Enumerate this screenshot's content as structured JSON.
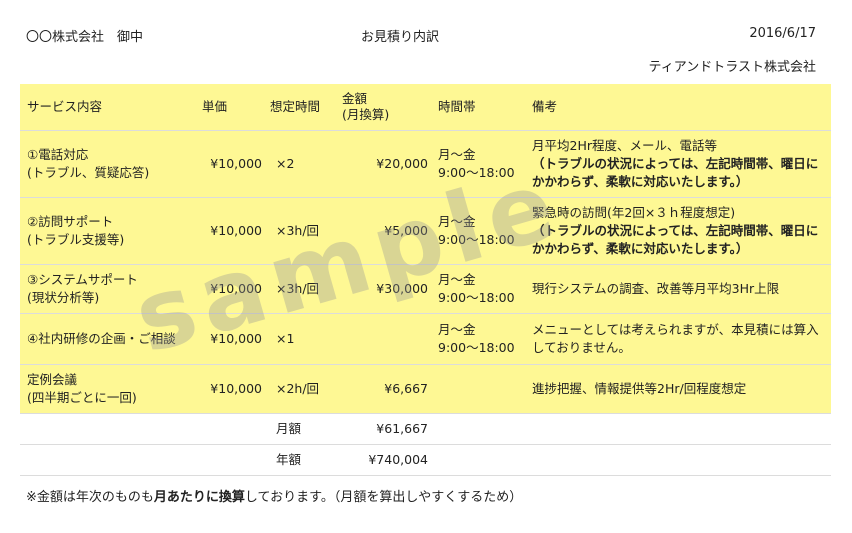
{
  "header": {
    "client": "〇〇株式会社　御中",
    "title": "お見積り内訳",
    "date": "2016/6/17",
    "company": "ティアンドトラスト株式会社"
  },
  "table": {
    "columns": {
      "service": "サービス内容",
      "unit_price": "単価",
      "expected_time": "想定時間",
      "amount_line1": "金額",
      "amount_line2": "(月換算)",
      "time_slot": "時間帯",
      "notes": "備考"
    },
    "rows": [
      {
        "service1": "①電話対応",
        "service2": "(トラブル、質疑応答)",
        "unit_price": "¥10,000",
        "expected_time": "×2",
        "amount": "¥20,000",
        "slot1": "月～金",
        "slot2": "9:00～18:00",
        "note1": "月平均2Hr程度、メール、電話等",
        "note_bold": "（トラブルの状況によっては、左記時間帯、曜日にかかわらず、柔軟に対応いたします。）"
      },
      {
        "service1": "②訪問サポート",
        "service2": "(トラブル支援等)",
        "unit_price": "¥10,000",
        "expected_time": "×3h/回",
        "amount": "¥5,000",
        "slot1": "月～金",
        "slot2": "9:00～18:00",
        "note1": "緊急時の訪問(年2回×３ｈ程度想定)",
        "note_bold": "（トラブルの状況によっては、左記時間帯、曜日にかかわらず、柔軟に対応いたします。）"
      },
      {
        "service1": "③システムサポート",
        "service2": "(現状分析等)",
        "unit_price": "¥10,000",
        "expected_time": "×3h/回",
        "amount": "¥30,000",
        "slot1": "月～金",
        "slot2": "9:00～18:00",
        "note1": "現行システムの調査、改善等月平均3Hr上限"
      },
      {
        "service1": "④社内研修の企画・ご相談",
        "unit_price": "¥10,000",
        "expected_time": "×1",
        "amount": "",
        "slot1": "月～金",
        "slot2": "9:00～18:00",
        "note1": "メニューとしては考えられますが、本見積には算入しておりません。"
      },
      {
        "service1": "定例会議",
        "service2": "(四半期ごとに一回)",
        "unit_price": "¥10,000",
        "expected_time": "×2h/回",
        "amount": "¥6,667",
        "note1": "進捗把握、情報提供等2Hr/回程度想定"
      }
    ],
    "totals": [
      {
        "label": "月額",
        "value": "¥61,667"
      },
      {
        "label": "年額",
        "value": "¥740,004"
      }
    ]
  },
  "footnote": {
    "prefix": "※金額は年次のものも",
    "bold": "月あたりに換算",
    "suffix": "しております。（月額を算出しやすくするため）"
  },
  "watermark": "sample"
}
